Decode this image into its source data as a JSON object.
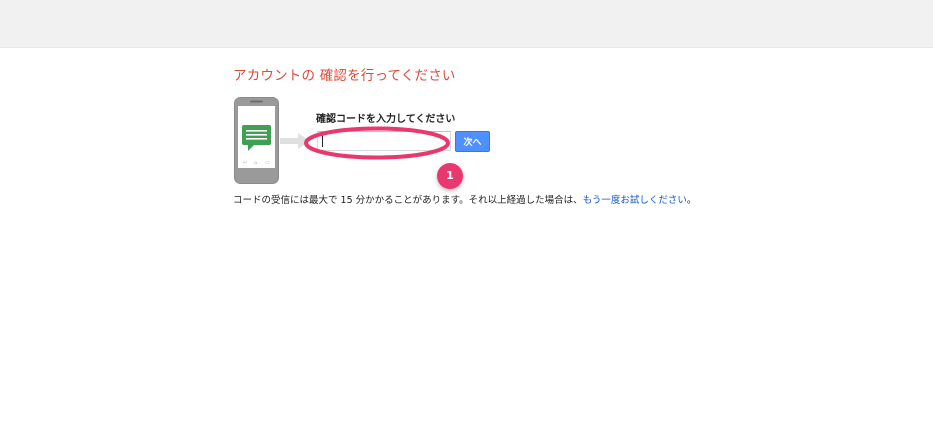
{
  "page": {
    "title": "アカウントの 確認を行ってください"
  },
  "verification": {
    "label": "確認コードを入力してください",
    "input_value": "",
    "next_button": "次へ"
  },
  "annotation": {
    "step_number": "1",
    "highlight_color": "#e8386d"
  },
  "help": {
    "text_before": "コードの受信には最大で 15 分かかることがあります。それ以上経過した場合は、",
    "link_text": "もう一度お試しください",
    "text_after": "。"
  },
  "colors": {
    "title": "#dd4b39",
    "button": "#4d90fe",
    "link": "#1155cc",
    "message_icon": "#3ea050"
  },
  "icons": {
    "phone": "smartphone-icon",
    "message": "chat-message-icon",
    "arrow": "arrow-right-icon"
  }
}
